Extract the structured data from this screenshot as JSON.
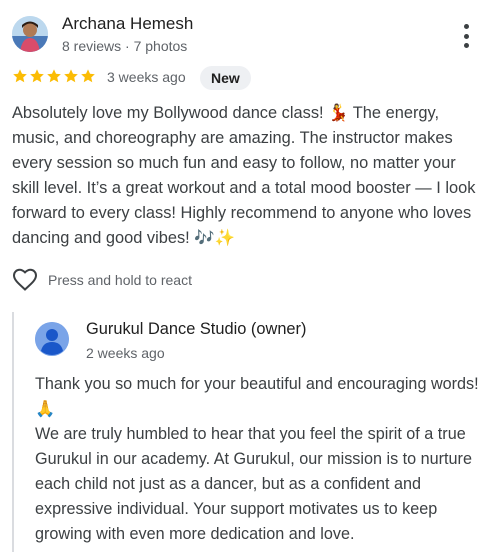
{
  "review": {
    "reviewer_name": "Archana Hemesh",
    "reviewer_meta": "8 reviews · 7 photos",
    "avatar_icon": "reviewer-photo",
    "rating": 5,
    "rating_max": 5,
    "star_color": "#fbbc04",
    "time": "3 weeks ago",
    "badge": "New",
    "text": "Absolutely love my Bollywood dance class! 💃 The energy, music, and choreography are amazing. The instructor makes every session so much fun and easy to follow, no matter your skill level. It’s a great workout and a total mood booster — I look forward to every class! Highly recommend to anyone who loves dancing and good vibes! 🎶✨",
    "react_label": "Press and hold to react",
    "react_icon": "heart-outline-icon",
    "menu_icon": "more-vert-icon"
  },
  "owner_reply": {
    "name": "Gurukul Dance Studio (owner)",
    "time": "2 weeks ago",
    "avatar_icon": "default-person-icon",
    "avatar_color": "#7aa4e8",
    "text": "Thank you so much for your beautiful and encouraging words! 🙏\nWe are truly humbled to hear that you feel the spirit of a true Gurukul in our academy. At Gurukul, our mission is to nurture each child not just as a dancer, but as a confident and expressive individual. Your support motivates us to keep growing with even more dedication and love."
  }
}
